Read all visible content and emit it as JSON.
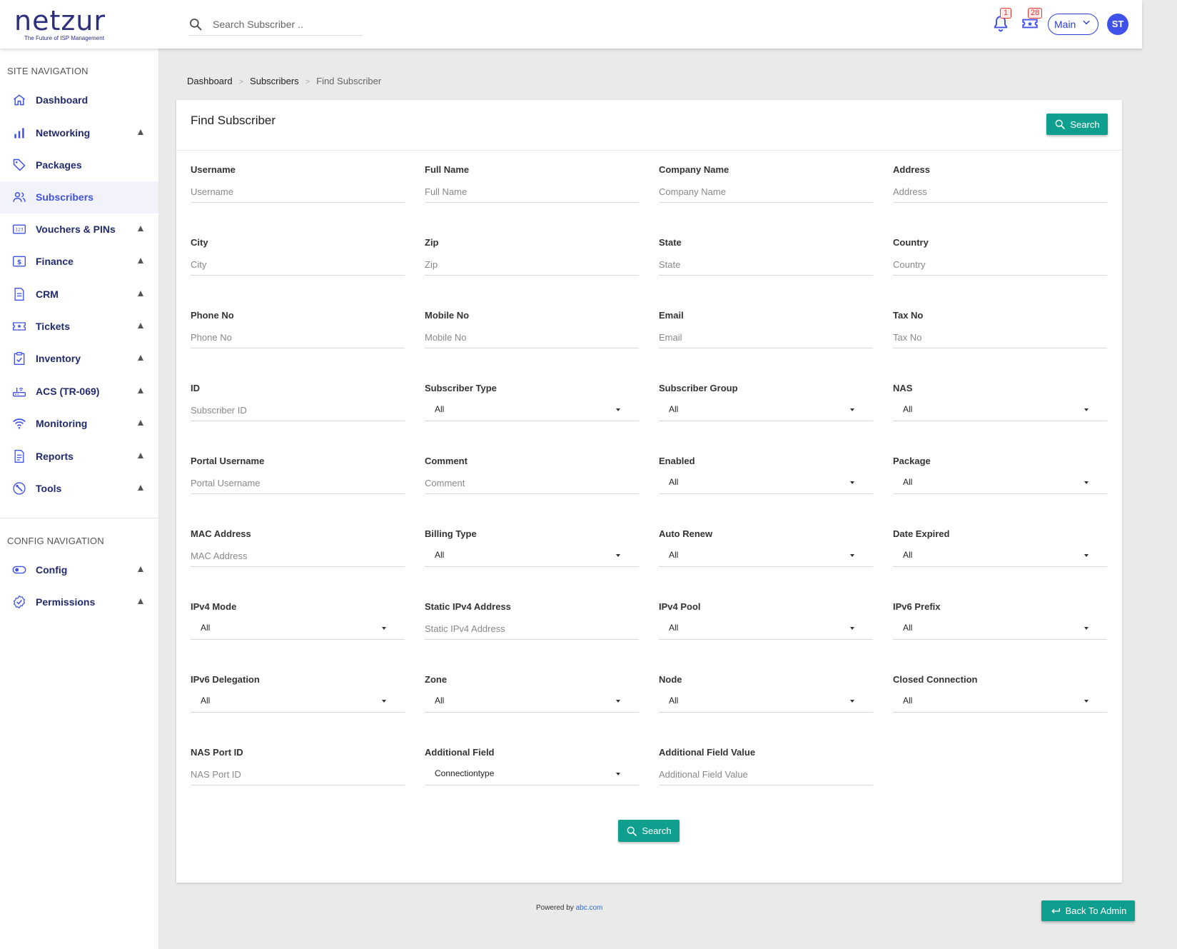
{
  "header": {
    "logo_text": "netzur",
    "logo_tagline": "The Future of ISP Management",
    "search_placeholder": "Search Subscriber ..",
    "notifications_count": "1",
    "tickets_count": "28",
    "workspace": "Main",
    "avatar_initials": "ST"
  },
  "sidebar": {
    "site_heading": "SITE NAVIGATION",
    "items": [
      {
        "label": "Dashboard",
        "icon": "home-icon",
        "expandable": false
      },
      {
        "label": "Networking",
        "icon": "bar-chart-icon",
        "expandable": true
      },
      {
        "label": "Packages",
        "icon": "tag-icon",
        "expandable": false
      },
      {
        "label": "Subscribers",
        "icon": "users-icon",
        "expandable": false,
        "active": true
      },
      {
        "label": "Vouchers & PINs",
        "icon": "voucher-icon",
        "expandable": true
      },
      {
        "label": "Finance",
        "icon": "dollar-icon",
        "expandable": true
      },
      {
        "label": "CRM",
        "icon": "document-icon",
        "expandable": true
      },
      {
        "label": "Tickets",
        "icon": "ticket-icon",
        "expandable": true
      },
      {
        "label": "Inventory",
        "icon": "clipboard-check-icon",
        "expandable": true
      },
      {
        "label": "ACS (TR-069)",
        "icon": "router-icon",
        "expandable": true
      },
      {
        "label": "Monitoring",
        "icon": "wifi-icon",
        "expandable": true
      },
      {
        "label": "Reports",
        "icon": "report-icon",
        "expandable": true
      },
      {
        "label": "Tools",
        "icon": "wrench-icon",
        "expandable": true
      }
    ],
    "config_heading": "CONFIG NAVIGATION",
    "config_items": [
      {
        "label": "Config",
        "icon": "toggle-icon",
        "expandable": true
      },
      {
        "label": "Permissions",
        "icon": "badge-check-icon",
        "expandable": true
      }
    ]
  },
  "breadcrumb": {
    "items": [
      "Dashboard",
      "Subscribers",
      "Find Subscriber"
    ],
    "separator": ">"
  },
  "form": {
    "title": "Find Subscriber",
    "search_button": "Search",
    "fields": [
      {
        "label": "Username",
        "type": "text",
        "placeholder": "Username"
      },
      {
        "label": "Full Name",
        "type": "text",
        "placeholder": "Full Name"
      },
      {
        "label": "Company Name",
        "type": "text",
        "placeholder": "Company Name"
      },
      {
        "label": "Address",
        "type": "text",
        "placeholder": "Address"
      },
      {
        "label": "City",
        "type": "text",
        "placeholder": "City"
      },
      {
        "label": "Zip",
        "type": "text",
        "placeholder": "Zip"
      },
      {
        "label": "State",
        "type": "text",
        "placeholder": "State"
      },
      {
        "label": "Country",
        "type": "text",
        "placeholder": "Country"
      },
      {
        "label": "Phone No",
        "type": "text",
        "placeholder": "Phone No"
      },
      {
        "label": "Mobile No",
        "type": "text",
        "placeholder": "Mobile No"
      },
      {
        "label": "Email",
        "type": "text",
        "placeholder": "Email"
      },
      {
        "label": "Tax No",
        "type": "text",
        "placeholder": "Tax No"
      },
      {
        "label": "ID",
        "type": "text",
        "placeholder": "Subscriber ID"
      },
      {
        "label": "Subscriber Type",
        "type": "select",
        "value": "All"
      },
      {
        "label": "Subscriber Group",
        "type": "select",
        "value": "All"
      },
      {
        "label": "NAS",
        "type": "select",
        "value": "All"
      },
      {
        "label": "Portal Username",
        "type": "text",
        "placeholder": "Portal Username"
      },
      {
        "label": "Comment",
        "type": "text",
        "placeholder": "Comment"
      },
      {
        "label": "Enabled",
        "type": "select",
        "value": "All"
      },
      {
        "label": "Package",
        "type": "select",
        "value": "All"
      },
      {
        "label": "MAC Address",
        "type": "text",
        "placeholder": "MAC Address"
      },
      {
        "label": "Billing Type",
        "type": "select",
        "value": "All"
      },
      {
        "label": "Auto Renew",
        "type": "select",
        "value": "All"
      },
      {
        "label": "Date Expired",
        "type": "select",
        "value": "All"
      },
      {
        "label": "IPv4 Mode",
        "type": "select",
        "value": "All"
      },
      {
        "label": "Static IPv4 Address",
        "type": "text",
        "placeholder": "Static IPv4 Address"
      },
      {
        "label": "IPv4 Pool",
        "type": "select",
        "value": "All"
      },
      {
        "label": "IPv6 Prefix",
        "type": "select",
        "value": "All"
      },
      {
        "label": "IPv6 Delegation",
        "type": "select",
        "value": "All"
      },
      {
        "label": "Zone",
        "type": "select",
        "value": "All"
      },
      {
        "label": "Node",
        "type": "select",
        "value": "All"
      },
      {
        "label": "Closed Connection",
        "type": "select",
        "value": "All"
      },
      {
        "label": "NAS Port ID",
        "type": "text",
        "placeholder": "NAS Port ID"
      },
      {
        "label": "Additional Field",
        "type": "select",
        "value": "Connectiontype"
      },
      {
        "label": "Additional Field Value",
        "type": "text",
        "placeholder": "Additional Field Value"
      }
    ]
  },
  "footer": {
    "powered_by": "Powered by",
    "link": "abc.com",
    "back_button": "Back To Admin"
  },
  "colors": {
    "brand": "#2b2f7c",
    "accent": "#3f51e8",
    "primary_button": "#0f9f8e",
    "badge": "#e53935"
  }
}
